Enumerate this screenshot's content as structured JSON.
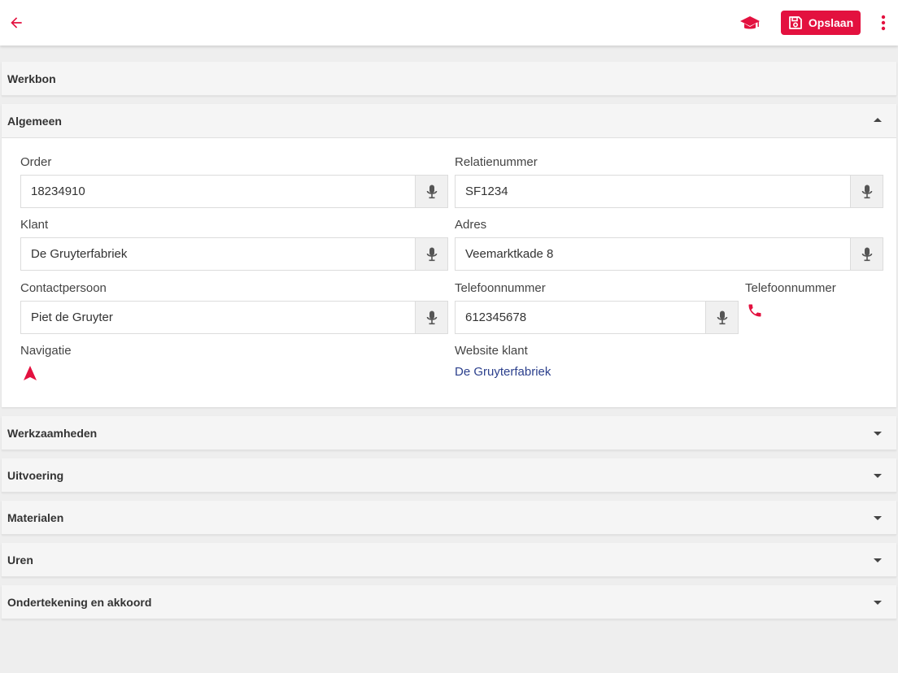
{
  "toolbar": {
    "save_label": "Opslaan",
    "accent": "#e3113f"
  },
  "sections": {
    "werkbon": "Werkbon",
    "algemeen": "Algemeen",
    "werkzaamheden": "Werkzaamheden",
    "uitvoering": "Uitvoering",
    "materialen": "Materialen",
    "uren": "Uren",
    "ondertekening": "Ondertekening en akkoord"
  },
  "form": {
    "order": {
      "label": "Order",
      "value": "18234910"
    },
    "relatienummer": {
      "label": "Relatienummer",
      "value": "SF1234"
    },
    "klant": {
      "label": "Klant",
      "value": "De Gruyterfabriek"
    },
    "adres": {
      "label": "Adres",
      "value": "Veemarktkade 8"
    },
    "contactpersoon": {
      "label": "Contactpersoon",
      "value": "Piet de Gruyter"
    },
    "telefoonnummer": {
      "label": "Telefoonnummer",
      "value": "612345678"
    },
    "telefoon_call": {
      "label": "Telefoonnummer"
    },
    "navigatie": {
      "label": "Navigatie"
    },
    "website": {
      "label": "Website klant",
      "link": "De Gruyterfabriek"
    }
  },
  "icons": {
    "back": "back-arrow-icon",
    "education": "graduation-cap-icon",
    "save": "floppy-disk-icon",
    "more": "more-vertical-icon",
    "mic": "microphone-icon",
    "phone": "phone-icon",
    "navigation": "navigation-arrow-icon"
  }
}
